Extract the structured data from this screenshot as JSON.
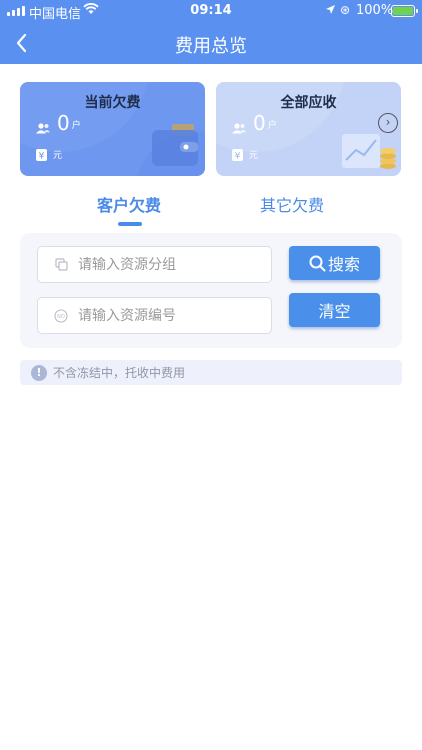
{
  "status_bar": {
    "carrier": "中国电信",
    "time": "09:14",
    "battery_pct": "100%"
  },
  "header": {
    "title": "费用总览"
  },
  "cards": [
    {
      "title": "当前欠费",
      "count": "0",
      "count_unit": "户",
      "amount_unit": "元"
    },
    {
      "title": "全部应收",
      "count": "0",
      "count_unit": "户",
      "amount_unit": "元"
    }
  ],
  "tabs": [
    {
      "label": "客户欠费",
      "active": true
    },
    {
      "label": "其它欠费",
      "active": false
    }
  ],
  "search": {
    "group_placeholder": "请输入资源分组",
    "code_placeholder": "请输入资源编号",
    "search_label": "搜索",
    "clear_label": "清空"
  },
  "notice": {
    "text": "不含冻结中，托收中费用"
  },
  "colors": {
    "header": "#5a91f0",
    "accent": "#4a90ea",
    "card1": "#6e97ef",
    "card2": "#c3d3f7"
  }
}
